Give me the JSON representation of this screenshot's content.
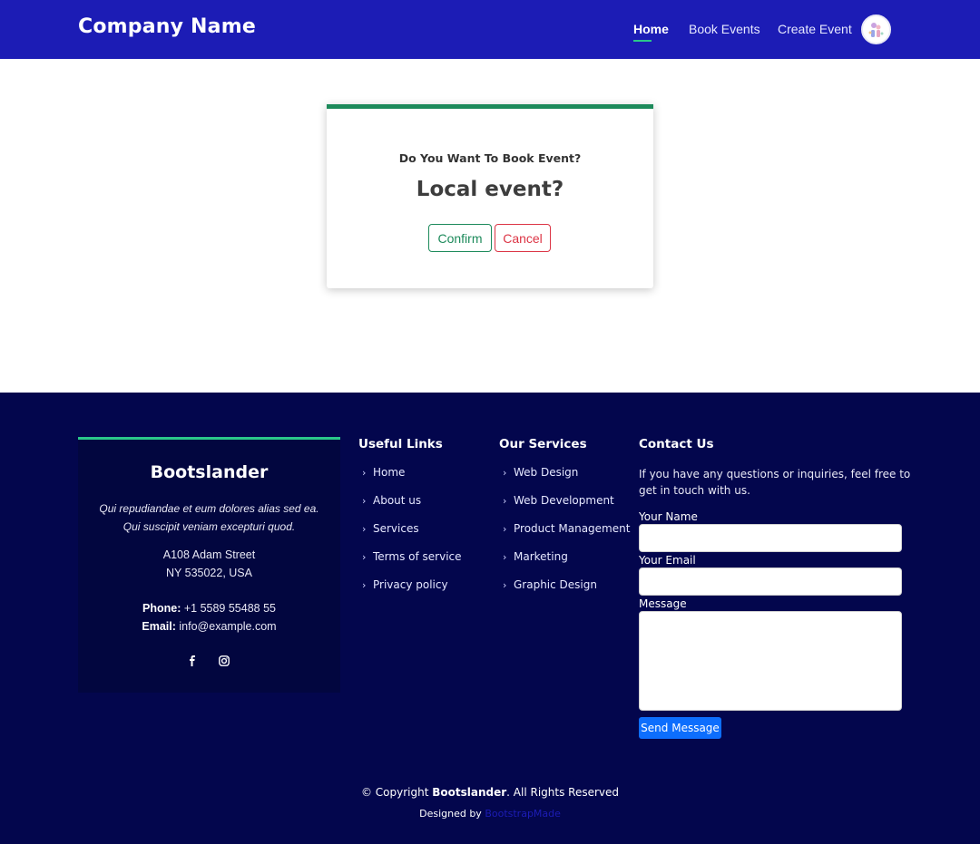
{
  "header": {
    "brand": "Company Name",
    "nav": [
      {
        "label": "Home",
        "active": true
      },
      {
        "label": "Book Events",
        "active": false
      },
      {
        "label": "Create Event",
        "active": false
      }
    ],
    "avatar_icon": "user-avatar-icon"
  },
  "modal": {
    "subtitle": "Do You Want To Book Event?",
    "title": "Local event?",
    "confirm_label": "Confirm",
    "cancel_label": "Cancel",
    "accent_color": "#1d8a5b",
    "cancel_color": "#dc3545"
  },
  "footer": {
    "about": {
      "title": "Bootslander",
      "text": "Qui repudiandae et eum dolores alias sed ea. Qui suscipit veniam excepturi quod.",
      "address_line1": "A108 Adam Street",
      "address_line2": "NY 535022, USA",
      "phone_label": "Phone:",
      "phone": "+1 5589 55488 55",
      "email_label": "Email:",
      "email": "info@example.com",
      "social": [
        "facebook-icon",
        "instagram-icon"
      ]
    },
    "useful_links": {
      "title": "Useful Links",
      "items": [
        "Home",
        "About us",
        "Services",
        "Terms of service",
        "Privacy policy"
      ]
    },
    "services": {
      "title": "Our Services",
      "items": [
        "Web Design",
        "Web Development",
        "Product Management",
        "Marketing",
        "Graphic Design"
      ]
    },
    "contact": {
      "title": "Contact Us",
      "text": "If you have any questions or inquiries, feel free to get in touch with us.",
      "name_label": "Your Name",
      "email_label": "Your Email",
      "message_label": "Message",
      "send_label": "Send Message"
    },
    "copyright_prefix": "© Copyright",
    "copyright_brand": "Bootslander",
    "copyright_suffix": ". All Rights Reserved",
    "designed_by_label": "Designed by",
    "designed_by_link": "BootstrapMade"
  },
  "colors": {
    "header_bg": "#1c1cb5",
    "footer_bg": "#03064d",
    "accent_green": "#2ac78a",
    "send_button": "#0d6efd"
  }
}
